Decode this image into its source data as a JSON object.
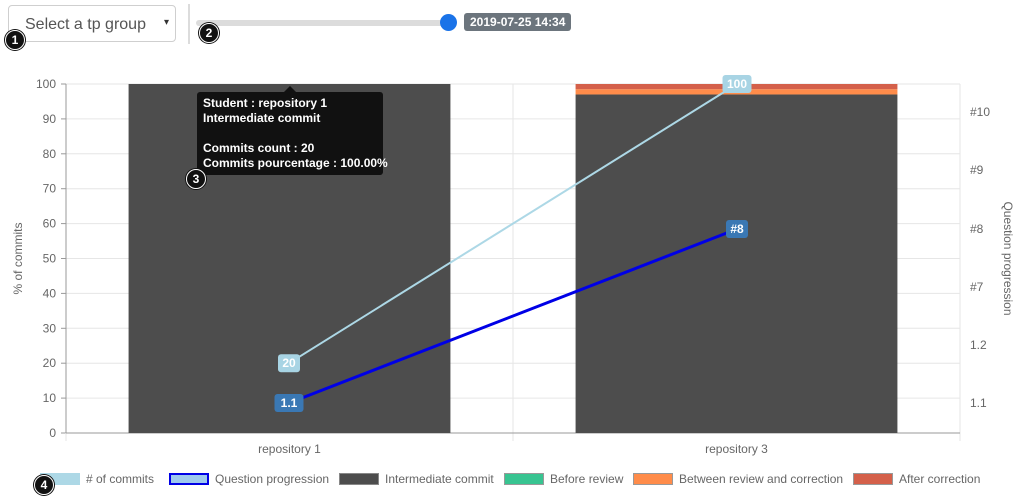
{
  "controls": {
    "group_select": {
      "label": "Select a tp group",
      "caret": "▾"
    },
    "date_slider": {
      "value_label": "2019-07-25 14:34",
      "position": 1.0
    }
  },
  "markers": [
    "1",
    "2",
    "3",
    "4"
  ],
  "tooltip": {
    "title": "Student : repository 1",
    "subtitle": "Intermediate commit",
    "count_line": "Commits count : 20",
    "pct_line": "Commits pourcentage : 100.00%"
  },
  "colors": {
    "intermediate": "#4d4d4d",
    "before_review": "#38c491",
    "between": "#ff8c4a",
    "after": "#d4604a",
    "commits_line": "#add8e6",
    "progression_line": "#0000e6",
    "label_light": "#a8d4e4",
    "label_dark": "#3a78b4"
  },
  "chart_data": {
    "type": "bar",
    "categories": [
      "repository 1",
      "repository 3"
    ],
    "ylabel": "% of commits",
    "ylim": [
      0,
      100
    ],
    "yticks": [
      "0",
      "10",
      "20",
      "30",
      "40",
      "50",
      "60",
      "70",
      "80",
      "90",
      "100"
    ],
    "y2label": "Question progression",
    "y2_ticks": [
      "1.1",
      "1.2",
      "#7",
      "#8",
      "#9",
      "#10"
    ],
    "series": [
      {
        "name": "Intermediate commit",
        "kind": "bar",
        "values": [
          100,
          97
        ]
      },
      {
        "name": "Before review",
        "kind": "bar",
        "values": [
          0,
          0
        ]
      },
      {
        "name": "Between review and correction",
        "kind": "bar",
        "values": [
          0,
          1.5
        ]
      },
      {
        "name": "After correction",
        "kind": "bar",
        "values": [
          0,
          1.5
        ]
      },
      {
        "name": "# of commits",
        "kind": "line",
        "values": [
          20,
          100
        ],
        "labels": [
          "20",
          "100"
        ]
      },
      {
        "name": "Question progression",
        "kind": "line",
        "values": [
          "1.1",
          "#8"
        ],
        "labels": [
          "1.1",
          "#8"
        ]
      }
    ],
    "legend": [
      "# of commits",
      "Question progression",
      "Intermediate commit",
      "Before review",
      "Between review and correction",
      "After correction"
    ],
    "legend_position": "bottom",
    "grid": true
  }
}
